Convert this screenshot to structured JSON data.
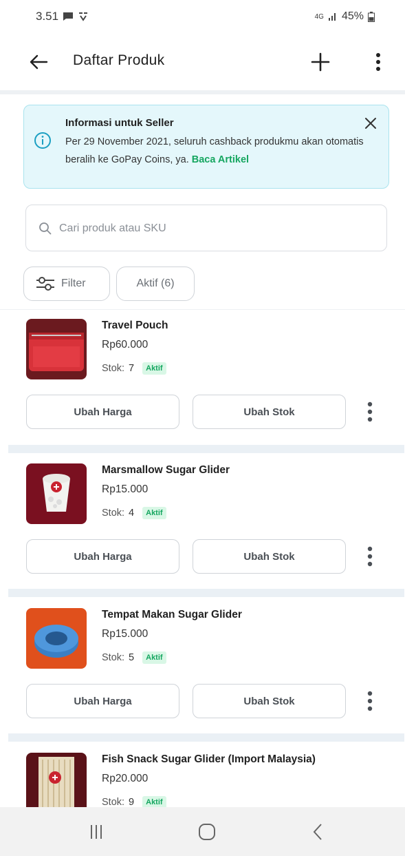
{
  "status_bar": {
    "time": "3.51",
    "network": "4G",
    "battery": "45%"
  },
  "app_bar": {
    "title": "Daftar Produk"
  },
  "info_banner": {
    "title": "Informasi untuk Seller",
    "body": "Per 29 November 2021, seluruh cashback produkmu akan otomatis beralih ke GoPay Coins, ya.",
    "link": "Baca Artikel"
  },
  "search": {
    "placeholder": "Cari produk atau SKU",
    "value": ""
  },
  "filters": {
    "filter_label": "Filter",
    "status_label": "Aktif (6)"
  },
  "labels": {
    "price_button": "Ubah Harga",
    "stock_button": "Ubah Stok",
    "stock_prefix": "Stok:"
  },
  "products": [
    {
      "name": "Travel Pouch",
      "price": "Rp60.000",
      "stock": "7",
      "status": "Aktif"
    },
    {
      "name": "Marsmallow Sugar Glider",
      "price": "Rp15.000",
      "stock": "4",
      "status": "Aktif"
    },
    {
      "name": "Tempat Makan Sugar Glider",
      "price": "Rp15.000",
      "stock": "5",
      "status": "Aktif"
    },
    {
      "name": "Fish Snack Sugar Glider (Import Malaysia)",
      "price": "Rp20.000",
      "stock": "9",
      "status": "Aktif"
    }
  ],
  "colors": {
    "accent_green": "#15a660",
    "banner_bg": "#e4f7fb",
    "banner_border": "#a9e3ee"
  }
}
